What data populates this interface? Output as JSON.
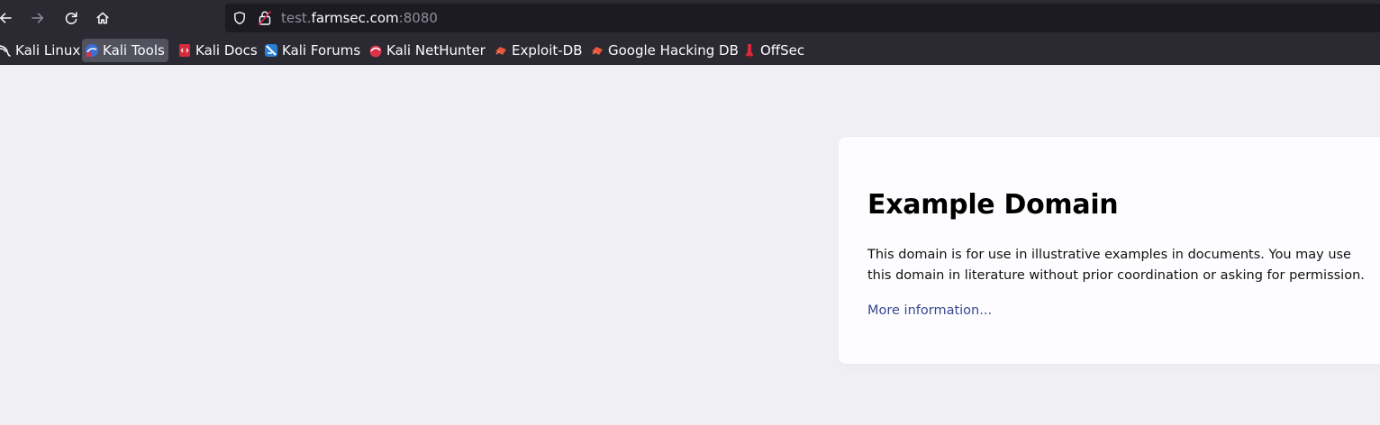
{
  "toolbar": {
    "back_icon": "arrow-left-icon",
    "forward_icon": "arrow-right-icon",
    "reload_icon": "reload-icon",
    "home_icon": "home-icon",
    "colors": {
      "chrome_bg": "#2b2a33",
      "urlbar_bg": "#1c1b22",
      "text": "#fbfbfe",
      "muted": "#8f8f9d"
    }
  },
  "urlbar": {
    "prefix": "test.",
    "host": "farmsec.com",
    "port": ":8080",
    "shield_icon": "shield-icon",
    "lock_icon": "insecure-lock-icon"
  },
  "bookmarks": [
    {
      "label": "Kali Linux",
      "icon": "kali-dragon-icon"
    },
    {
      "label": "Kali Tools",
      "icon": "kali-tools-icon",
      "active": true
    },
    {
      "label": "Kali Docs",
      "icon": "kali-docs-icon"
    },
    {
      "label": "Kali Forums",
      "icon": "kali-forums-icon"
    },
    {
      "label": "Kali NetHunter",
      "icon": "kali-nethunter-icon"
    },
    {
      "label": "Exploit-DB",
      "icon": "exploit-db-icon"
    },
    {
      "label": "Google Hacking DB",
      "icon": "ghdb-icon"
    },
    {
      "label": "OffSec",
      "icon": "offsec-icon"
    }
  ],
  "page": {
    "background": "#f0f0f2",
    "heading": "Example Domain",
    "paragraph": "This domain is for use in illustrative examples in documents. You may use this domain in literature without prior coordination or asking for permission.",
    "link": "More information...",
    "link_color": "#38488f"
  }
}
